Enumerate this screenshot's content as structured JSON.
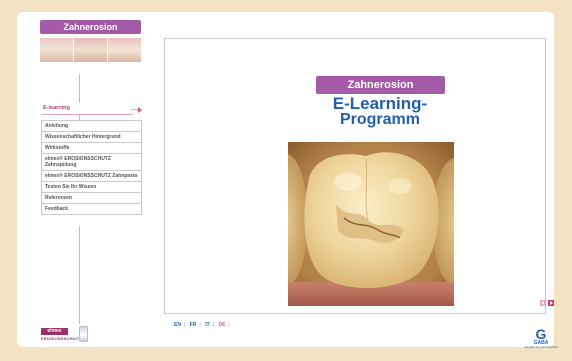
{
  "sidebar": {
    "title": "Zahnerosion",
    "active_item": "E-learning",
    "items": [
      {
        "label": "Anleitung"
      },
      {
        "label": "Wissenschaftlicher Hintergrund"
      },
      {
        "label": "Wirkstoffe"
      },
      {
        "label": "elmex® EROSIONSSCHUTZ Zahnspülung"
      },
      {
        "label": "elmex® EROSIONSSCHUTZ Zahnpasta"
      },
      {
        "label": "Testen Sie Ihr Wissen"
      },
      {
        "label": "Referenzen"
      },
      {
        "label": "Feedback"
      }
    ],
    "brand": {
      "logo": "elmex",
      "product": "EROSIONSSCHUTZ"
    }
  },
  "main": {
    "badge": "Zahnerosion",
    "title_line1": "E-Learning-",
    "title_line2": "Programm"
  },
  "footer": {
    "languages": [
      "EN",
      "FR",
      "IT",
      "DE"
    ],
    "active_language": "DE",
    "company": "GABA",
    "tagline": "Spezialist für orale Prävention"
  },
  "colors": {
    "accent_purple": "#a35aa7",
    "title_blue": "#2360a8",
    "pink": "#d8356f",
    "background": "#f4e2c4"
  }
}
